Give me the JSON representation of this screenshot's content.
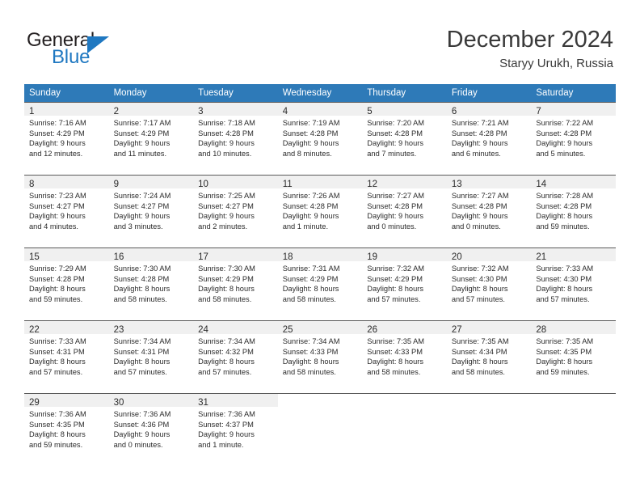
{
  "brand": {
    "word_one": "General",
    "word_two": "Blue",
    "triangle_icon": "triangle-icon",
    "accent_color": "#1f78c1"
  },
  "header": {
    "title": "December 2024",
    "location": "Staryy Urukh, Russia"
  },
  "calendar": {
    "header_bg": "#2e7ab8",
    "daynum_bg": "#f0f0f0",
    "weekdays": [
      "Sunday",
      "Monday",
      "Tuesday",
      "Wednesday",
      "Thursday",
      "Friday",
      "Saturday"
    ],
    "weeks": [
      [
        {
          "day": "1",
          "sunrise": "Sunrise: 7:16 AM",
          "sunset": "Sunset: 4:29 PM",
          "daylight_1": "Daylight: 9 hours",
          "daylight_2": "and 12 minutes."
        },
        {
          "day": "2",
          "sunrise": "Sunrise: 7:17 AM",
          "sunset": "Sunset: 4:29 PM",
          "daylight_1": "Daylight: 9 hours",
          "daylight_2": "and 11 minutes."
        },
        {
          "day": "3",
          "sunrise": "Sunrise: 7:18 AM",
          "sunset": "Sunset: 4:28 PM",
          "daylight_1": "Daylight: 9 hours",
          "daylight_2": "and 10 minutes."
        },
        {
          "day": "4",
          "sunrise": "Sunrise: 7:19 AM",
          "sunset": "Sunset: 4:28 PM",
          "daylight_1": "Daylight: 9 hours",
          "daylight_2": "and 8 minutes."
        },
        {
          "day": "5",
          "sunrise": "Sunrise: 7:20 AM",
          "sunset": "Sunset: 4:28 PM",
          "daylight_1": "Daylight: 9 hours",
          "daylight_2": "and 7 minutes."
        },
        {
          "day": "6",
          "sunrise": "Sunrise: 7:21 AM",
          "sunset": "Sunset: 4:28 PM",
          "daylight_1": "Daylight: 9 hours",
          "daylight_2": "and 6 minutes."
        },
        {
          "day": "7",
          "sunrise": "Sunrise: 7:22 AM",
          "sunset": "Sunset: 4:28 PM",
          "daylight_1": "Daylight: 9 hours",
          "daylight_2": "and 5 minutes."
        }
      ],
      [
        {
          "day": "8",
          "sunrise": "Sunrise: 7:23 AM",
          "sunset": "Sunset: 4:27 PM",
          "daylight_1": "Daylight: 9 hours",
          "daylight_2": "and 4 minutes."
        },
        {
          "day": "9",
          "sunrise": "Sunrise: 7:24 AM",
          "sunset": "Sunset: 4:27 PM",
          "daylight_1": "Daylight: 9 hours",
          "daylight_2": "and 3 minutes."
        },
        {
          "day": "10",
          "sunrise": "Sunrise: 7:25 AM",
          "sunset": "Sunset: 4:27 PM",
          "daylight_1": "Daylight: 9 hours",
          "daylight_2": "and 2 minutes."
        },
        {
          "day": "11",
          "sunrise": "Sunrise: 7:26 AM",
          "sunset": "Sunset: 4:28 PM",
          "daylight_1": "Daylight: 9 hours",
          "daylight_2": "and 1 minute."
        },
        {
          "day": "12",
          "sunrise": "Sunrise: 7:27 AM",
          "sunset": "Sunset: 4:28 PM",
          "daylight_1": "Daylight: 9 hours",
          "daylight_2": "and 0 minutes."
        },
        {
          "day": "13",
          "sunrise": "Sunrise: 7:27 AM",
          "sunset": "Sunset: 4:28 PM",
          "daylight_1": "Daylight: 9 hours",
          "daylight_2": "and 0 minutes."
        },
        {
          "day": "14",
          "sunrise": "Sunrise: 7:28 AM",
          "sunset": "Sunset: 4:28 PM",
          "daylight_1": "Daylight: 8 hours",
          "daylight_2": "and 59 minutes."
        }
      ],
      [
        {
          "day": "15",
          "sunrise": "Sunrise: 7:29 AM",
          "sunset": "Sunset: 4:28 PM",
          "daylight_1": "Daylight: 8 hours",
          "daylight_2": "and 59 minutes."
        },
        {
          "day": "16",
          "sunrise": "Sunrise: 7:30 AM",
          "sunset": "Sunset: 4:28 PM",
          "daylight_1": "Daylight: 8 hours",
          "daylight_2": "and 58 minutes."
        },
        {
          "day": "17",
          "sunrise": "Sunrise: 7:30 AM",
          "sunset": "Sunset: 4:29 PM",
          "daylight_1": "Daylight: 8 hours",
          "daylight_2": "and 58 minutes."
        },
        {
          "day": "18",
          "sunrise": "Sunrise: 7:31 AM",
          "sunset": "Sunset: 4:29 PM",
          "daylight_1": "Daylight: 8 hours",
          "daylight_2": "and 58 minutes."
        },
        {
          "day": "19",
          "sunrise": "Sunrise: 7:32 AM",
          "sunset": "Sunset: 4:29 PM",
          "daylight_1": "Daylight: 8 hours",
          "daylight_2": "and 57 minutes."
        },
        {
          "day": "20",
          "sunrise": "Sunrise: 7:32 AM",
          "sunset": "Sunset: 4:30 PM",
          "daylight_1": "Daylight: 8 hours",
          "daylight_2": "and 57 minutes."
        },
        {
          "day": "21",
          "sunrise": "Sunrise: 7:33 AM",
          "sunset": "Sunset: 4:30 PM",
          "daylight_1": "Daylight: 8 hours",
          "daylight_2": "and 57 minutes."
        }
      ],
      [
        {
          "day": "22",
          "sunrise": "Sunrise: 7:33 AM",
          "sunset": "Sunset: 4:31 PM",
          "daylight_1": "Daylight: 8 hours",
          "daylight_2": "and 57 minutes."
        },
        {
          "day": "23",
          "sunrise": "Sunrise: 7:34 AM",
          "sunset": "Sunset: 4:31 PM",
          "daylight_1": "Daylight: 8 hours",
          "daylight_2": "and 57 minutes."
        },
        {
          "day": "24",
          "sunrise": "Sunrise: 7:34 AM",
          "sunset": "Sunset: 4:32 PM",
          "daylight_1": "Daylight: 8 hours",
          "daylight_2": "and 57 minutes."
        },
        {
          "day": "25",
          "sunrise": "Sunrise: 7:34 AM",
          "sunset": "Sunset: 4:33 PM",
          "daylight_1": "Daylight: 8 hours",
          "daylight_2": "and 58 minutes."
        },
        {
          "day": "26",
          "sunrise": "Sunrise: 7:35 AM",
          "sunset": "Sunset: 4:33 PM",
          "daylight_1": "Daylight: 8 hours",
          "daylight_2": "and 58 minutes."
        },
        {
          "day": "27",
          "sunrise": "Sunrise: 7:35 AM",
          "sunset": "Sunset: 4:34 PM",
          "daylight_1": "Daylight: 8 hours",
          "daylight_2": "and 58 minutes."
        },
        {
          "day": "28",
          "sunrise": "Sunrise: 7:35 AM",
          "sunset": "Sunset: 4:35 PM",
          "daylight_1": "Daylight: 8 hours",
          "daylight_2": "and 59 minutes."
        }
      ],
      [
        {
          "day": "29",
          "sunrise": "Sunrise: 7:36 AM",
          "sunset": "Sunset: 4:35 PM",
          "daylight_1": "Daylight: 8 hours",
          "daylight_2": "and 59 minutes."
        },
        {
          "day": "30",
          "sunrise": "Sunrise: 7:36 AM",
          "sunset": "Sunset: 4:36 PM",
          "daylight_1": "Daylight: 9 hours",
          "daylight_2": "and 0 minutes."
        },
        {
          "day": "31",
          "sunrise": "Sunrise: 7:36 AM",
          "sunset": "Sunset: 4:37 PM",
          "daylight_1": "Daylight: 9 hours",
          "daylight_2": "and 1 minute."
        },
        null,
        null,
        null,
        null
      ]
    ]
  }
}
